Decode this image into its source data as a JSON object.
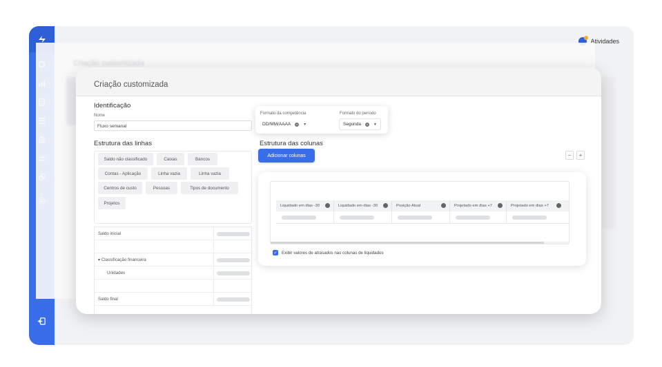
{
  "topbar": {
    "activities_label": "Atividades"
  },
  "background_page": {
    "title": "Criação customizada"
  },
  "modal": {
    "title": "Criação customizada",
    "identification": {
      "section_title": "Identificação",
      "name_label": "Nome",
      "name_value": "Fluxo semanal"
    },
    "format_popover": {
      "competencia_label": "Formato da competência",
      "competencia_value": "DD/MM/AAAA",
      "periodo_label": "Formato do período",
      "periodo_value": "Segunda"
    },
    "lines": {
      "section_title": "Estrutura das linhas",
      "chips": [
        "Saldo não classificado",
        "Caixas",
        "Bancos",
        "Contas - Aplicação",
        "Linha vazia",
        "Linha vazia",
        "Centros de custo",
        "Pessoas",
        "Tipos de documento",
        "Projetos"
      ],
      "rows": [
        "Saldo inicial",
        "",
        "▾ Classificação financeira",
        "Unidades",
        "",
        "Saldo final"
      ]
    },
    "columns": {
      "section_title": "Estrutura das colunas",
      "add_button": "Adicionar colunas",
      "minus": "−",
      "plus": "+",
      "headers": [
        "Liquidado em dias -30",
        "Liquidado em dias -30",
        "Posição Atual",
        "Projetado em dias +7",
        "Projetado em dias +7"
      ],
      "checkbox_label": "Exibir valores de atrasados nas colunas de liquidados",
      "checkbox_checked": true
    }
  }
}
